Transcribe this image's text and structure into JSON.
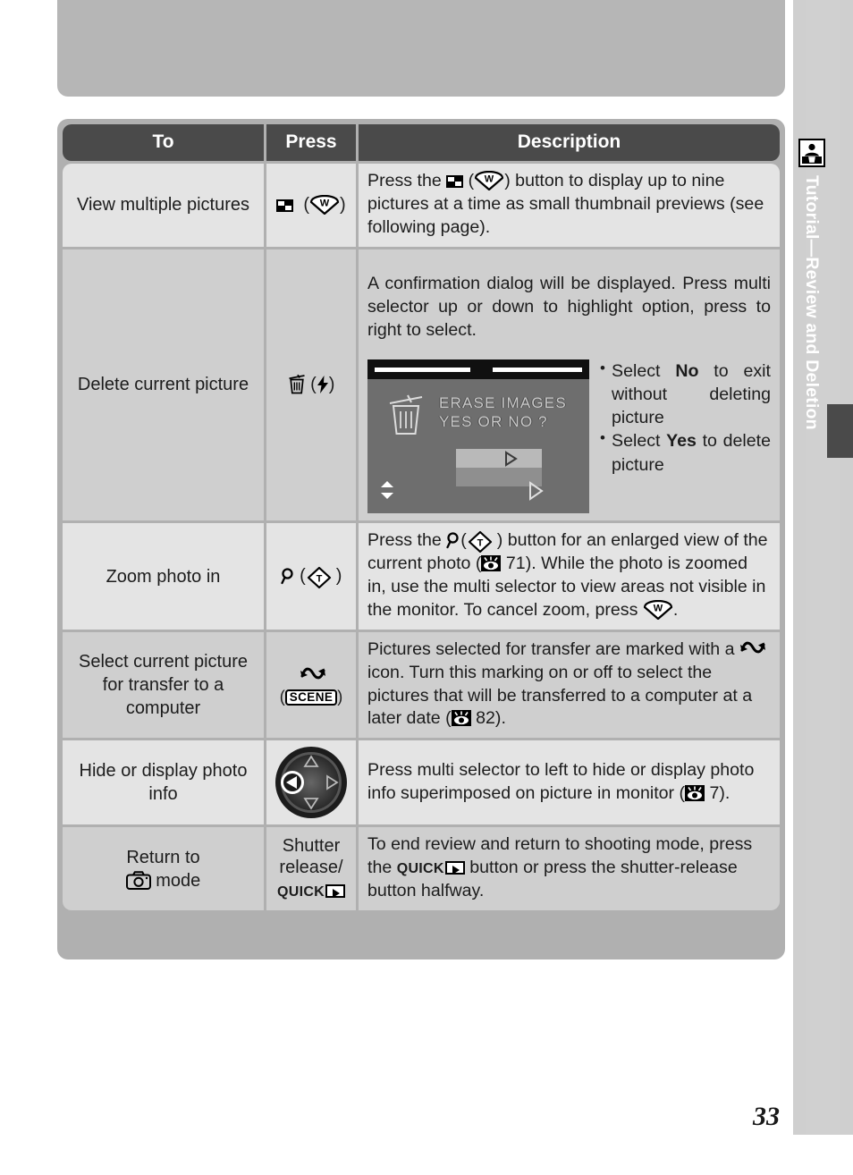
{
  "page": {
    "number": "33",
    "chapter_tab": "Tutorial—Review and Deletion",
    "tab_icon": "portrait-person-icon"
  },
  "table": {
    "headers": {
      "to": "To",
      "press": "Press",
      "description": "Description"
    },
    "rows": [
      {
        "to": "View multiple pictures",
        "press_icons": [
          "thumbnail-grid-icon",
          "wide-zoom-w-button"
        ],
        "description_parts": {
          "p1": "Press the",
          "p2": ") button to display up to nine pictures at a time as small thumbnail previews (see following page)."
        }
      },
      {
        "to": "Delete current picture",
        "press_icons": [
          "trash-can-icon",
          "flash-bolt-icon"
        ],
        "description_parts": {
          "intro": "A confirmation dialog will be displayed.  Press multi selector up or down to highlight option, press to right to select."
        },
        "lcd": {
          "line1": "ERASE IMAGES",
          "line2": "YES OR NO  ?"
        },
        "bullets": [
          {
            "pre": "Select ",
            "bold": "No",
            "post": " to exit without deleting picture"
          },
          {
            "pre": "Select ",
            "bold": "Yes",
            "post": " to delete picture"
          }
        ]
      },
      {
        "to": "Zoom photo in",
        "press_icons": [
          "magnifier-icon",
          "tele-zoom-t-button"
        ],
        "description_parts": {
          "p1": "Press the",
          "p2": ") button for an enlarged view of the current photo (",
          "ref1": "71",
          "p3": ").  While the photo is zoomed in, use the multi selector to view areas not visible in the monitor.  To cancel zoom, press",
          "p4": "."
        }
      },
      {
        "to": "Select current picture for transfer to a computer",
        "press_icons": [
          "transfer-wave-icon",
          "scene-button"
        ],
        "press_label": "SCENE",
        "description_parts": {
          "p1": "Pictures selected for transfer are marked with a",
          "p2": "icon.  Turn this marking on or off to select the pictures that will be transferred to a computer at a later date (",
          "ref1": "82",
          "p3": ")."
        }
      },
      {
        "to": "Hide or display photo info",
        "press_icons": [
          "multi-selector-dial-left"
        ],
        "description_parts": {
          "p1": "Press multi selector to left to hide or display photo info superimposed on picture in monitor (",
          "ref1": "7",
          "p2": ")."
        }
      },
      {
        "to_parts": {
          "p1": "Return to",
          "p2": "mode"
        },
        "to_icon": "camera-icon",
        "press_label_line1": "Shutter",
        "press_label_line2": "release/",
        "press_label_line3": "QUICK",
        "description_parts": {
          "p1": "To end review and return to shooting mode, press the",
          "p2": "button or press the shutter-release button halfway."
        }
      }
    ]
  }
}
